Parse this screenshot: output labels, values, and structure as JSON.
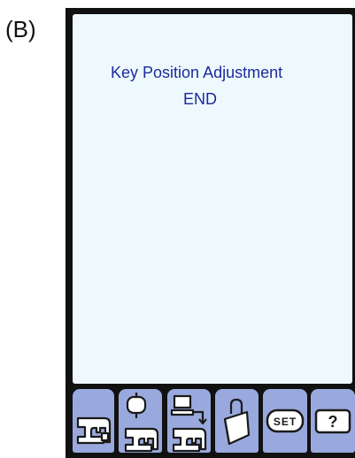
{
  "figure_label": "(B)",
  "screen": {
    "title_line1": "Key Position Adjustment",
    "title_line2": "END"
  },
  "bottom_toolbar": {
    "buttons": [
      {
        "icon": "sewing-machine-icon"
      },
      {
        "icon": "embroidery-machine-icon"
      },
      {
        "icon": "computer-link-icon"
      },
      {
        "icon": "pocket-storage-icon"
      },
      {
        "icon": "set-icon",
        "label": "SET"
      },
      {
        "icon": "help-icon",
        "label": "?"
      }
    ]
  },
  "colors": {
    "bezel": "#111111",
    "screen_bg": "#eef9fd",
    "text": "#1d2a9c",
    "button_bg": "#9aa9dd",
    "icon_fill": "#ffffff",
    "icon_stroke": "#1a1a1a"
  }
}
